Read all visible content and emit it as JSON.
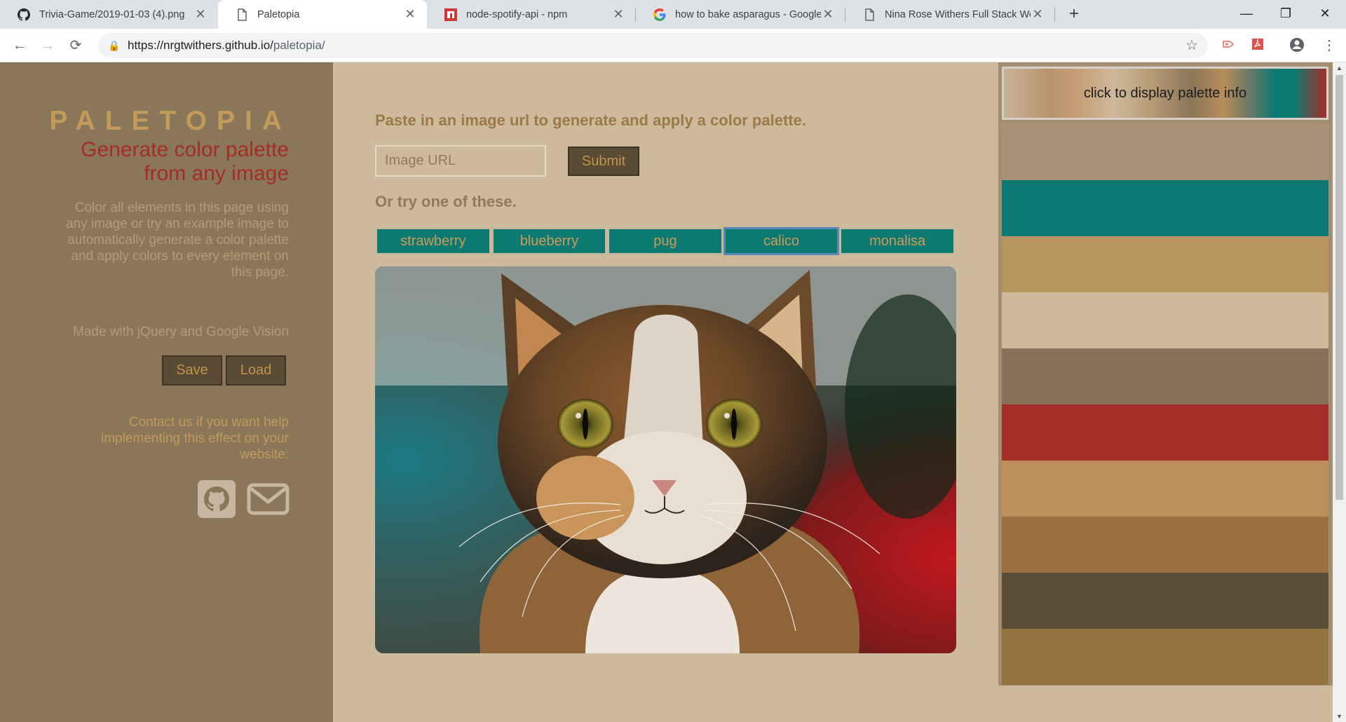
{
  "browser": {
    "tabs": [
      {
        "title": "Trivia-Game/2019-01-03 (4).png",
        "icon": "github-icon",
        "active": false
      },
      {
        "title": "Paletopia",
        "icon": "page-icon",
        "active": true
      },
      {
        "title": "node-spotify-api - npm",
        "icon": "npm-icon",
        "active": false
      },
      {
        "title": "how to bake asparagus - Google",
        "icon": "google-icon",
        "active": false
      },
      {
        "title": "Nina Rose Withers Full Stack Web",
        "icon": "page-icon",
        "active": false
      }
    ],
    "url": {
      "host": "https://nrgtwithers.github.io/",
      "path": "paletopia/"
    }
  },
  "sidebar": {
    "brand": "PALETOPIA",
    "tagline": "Generate color palette from any image",
    "description": "Color all elements in this page using any image or try an example image to automatically generate a color palette and apply colors to every element on this page.",
    "made_with": "Made with jQuery and Google Vision",
    "save_label": "Save",
    "load_label": "Load",
    "contact": "Contact us if you want help implementing this effect on your website:",
    "icons": [
      "github-icon",
      "mail-icon"
    ]
  },
  "main": {
    "prompt": "Paste in an image url to generate and apply a color palette.",
    "url_placeholder": "Image URL",
    "submit_label": "Submit",
    "try_label": "Or try one of these.",
    "examples": [
      "strawberry",
      "blueberry",
      "pug",
      "calico",
      "monalisa"
    ],
    "selected_example": "calico"
  },
  "palette": {
    "button_label": "click to display palette info",
    "swatches": [
      "#a89378",
      "#0c7a72",
      "#b8955f",
      "#cdb99c",
      "#857259",
      "#a52d28",
      "#bd8f5a",
      "#9b6f3f",
      "#5b4e36",
      "#957340"
    ]
  },
  "colors": {
    "sidebar_bg": "#8a7659",
    "main_bg": "#cdb99c",
    "accent_teal": "#0d7a72",
    "accent_red": "#a52d28",
    "accent_gold": "#c29a5a",
    "button_dark": "#5a4b35"
  }
}
